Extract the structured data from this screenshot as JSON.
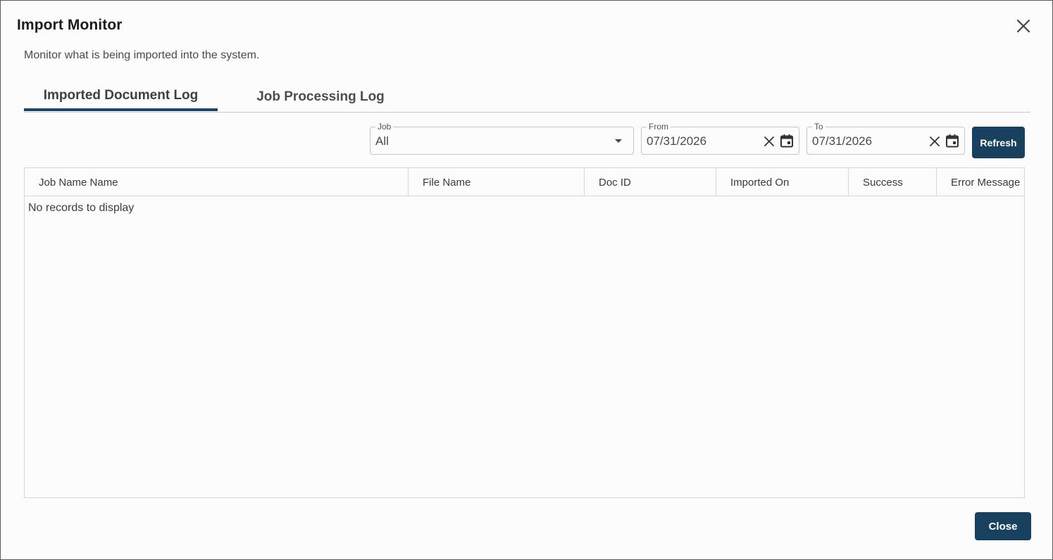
{
  "dialog": {
    "title": "Import Monitor",
    "subtitle": "Monitor what is being imported into the system."
  },
  "tabs": [
    {
      "label": "Imported Document Log",
      "active": true
    },
    {
      "label": "Job Processing Log",
      "active": false
    }
  ],
  "filters": {
    "job": {
      "label": "Job",
      "value": "All"
    },
    "from": {
      "label": "From",
      "value": "07/31/2026"
    },
    "to": {
      "label": "To",
      "value": "07/31/2026"
    },
    "refresh_label": "Refresh"
  },
  "grid": {
    "columns": [
      "Job Name Name",
      "File Name",
      "Doc ID",
      "Imported On",
      "Success",
      "Error Message"
    ],
    "empty_message": "No records to display"
  },
  "footer": {
    "close_label": "Close"
  },
  "colors": {
    "accent": "#18415f",
    "tab_indicator": "#1a4566"
  },
  "icons": {
    "close": "close-icon",
    "clear": "clear-icon",
    "calendar": "calendar-icon",
    "dropdown": "chevron-down-icon"
  }
}
